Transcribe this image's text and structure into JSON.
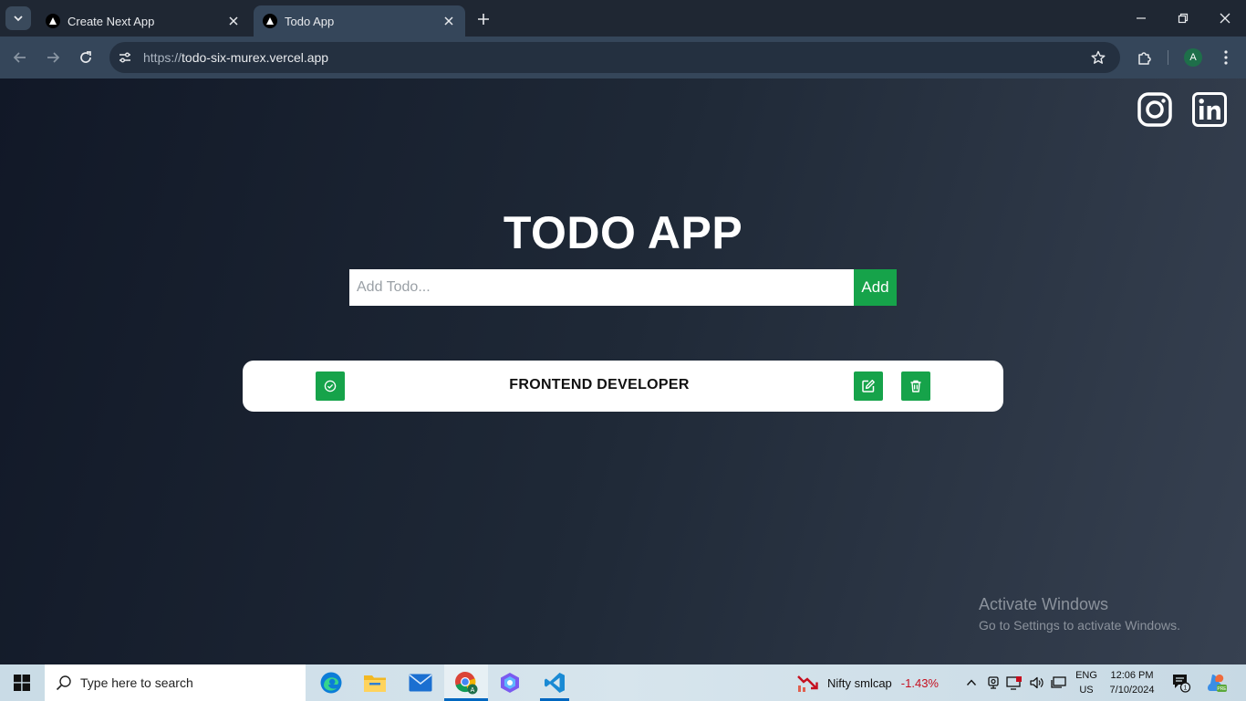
{
  "browser": {
    "tabs": [
      {
        "title": "Create Next App",
        "active": false
      },
      {
        "title": "Todo App",
        "active": true
      }
    ],
    "url_scheme": "https://",
    "url_host": "todo-six-murex.vercel.app",
    "profile_initial": "A"
  },
  "page": {
    "title": "TODO APP",
    "input_placeholder": "Add Todo...",
    "add_button_label": "Add",
    "todos": [
      {
        "text": "FRONTEND DEVELOPER"
      }
    ],
    "social_links": [
      "instagram-icon",
      "linkedin-icon"
    ]
  },
  "watermark": {
    "line1": "Activate Windows",
    "line2": "Go to Settings to activate Windows."
  },
  "taskbar": {
    "search_placeholder": "Type here to search",
    "pinned_apps": [
      "edge-icon",
      "file-explorer-icon",
      "mail-icon",
      "chrome-icon",
      "copilot-icon",
      "vscode-icon"
    ],
    "widget_name": "Nifty smlcap",
    "widget_change": "-1.43%",
    "lang_line1": "ENG",
    "lang_line2": "US",
    "time": "12:06 PM",
    "date": "7/10/2024",
    "notification_count": "1"
  },
  "colors": {
    "accent_green": "#16a34a",
    "negative_red": "#c50f1f",
    "chrome_toolbar": "#35465a"
  }
}
